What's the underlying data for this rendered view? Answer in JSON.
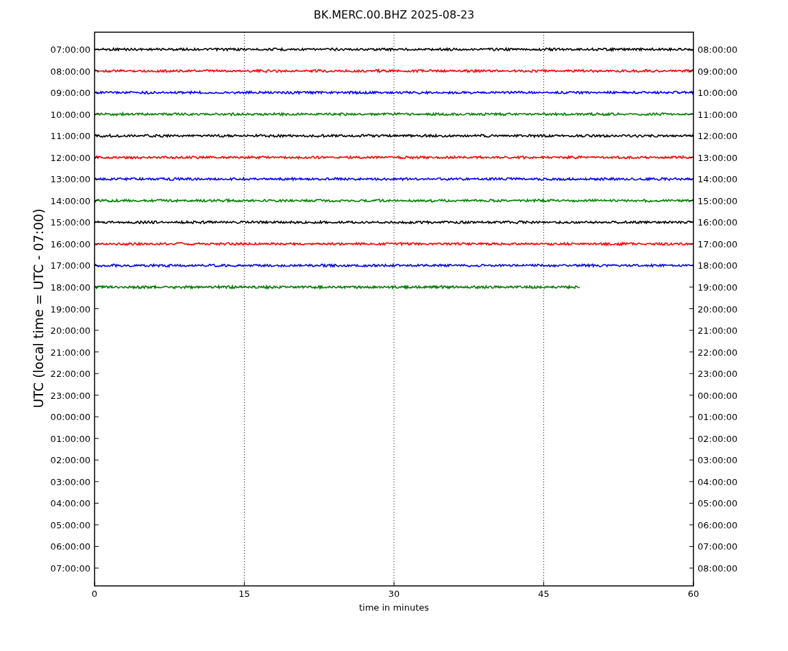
{
  "title": "BK.MERC.00.BHZ 2025-08-23",
  "ylabel": "UTC (local time = UTC - 07:00)",
  "xlabel": "time in minutes",
  "xticks": [
    "0",
    "15",
    "30",
    "45",
    "60"
  ],
  "left_labels": [
    "07:00:00",
    "08:00:00",
    "09:00:00",
    "10:00:00",
    "11:00:00",
    "12:00:00",
    "13:00:00",
    "14:00:00",
    "15:00:00",
    "16:00:00",
    "17:00:00",
    "18:00:00",
    "19:00:00",
    "20:00:00",
    "21:00:00",
    "22:00:00",
    "23:00:00",
    "00:00:00",
    "01:00:00",
    "02:00:00",
    "03:00:00",
    "04:00:00",
    "05:00:00",
    "06:00:00",
    "07:00:00"
  ],
  "right_labels": [
    "08:00:00",
    "09:00:00",
    "10:00:00",
    "11:00:00",
    "12:00:00",
    "13:00:00",
    "14:00:00",
    "15:00:00",
    "16:00:00",
    "17:00:00",
    "18:00:00",
    "19:00:00",
    "20:00:00",
    "21:00:00",
    "22:00:00",
    "23:00:00",
    "00:00:00",
    "01:00:00",
    "02:00:00",
    "03:00:00",
    "04:00:00",
    "05:00:00",
    "06:00:00",
    "07:00:00",
    "08:00:00"
  ],
  "traces": [
    {
      "color": "#000000",
      "level": 1
    },
    {
      "color": "#ff0000",
      "level": 1
    },
    {
      "color": "#0000ff",
      "level": 1
    },
    {
      "color": "#008000",
      "level": 1
    },
    {
      "color": "#000000",
      "level": 1
    },
    {
      "color": "#ff0000",
      "level": 1
    },
    {
      "color": "#0000ff",
      "level": 1
    },
    {
      "color": "#008000",
      "level": 1
    },
    {
      "color": "#000000",
      "level": 1
    },
    {
      "color": "#ff0000",
      "level": 1
    },
    {
      "color": "#0000ff",
      "level": 1
    },
    {
      "color": "#008000",
      "level": 0.81
    }
  ]
}
